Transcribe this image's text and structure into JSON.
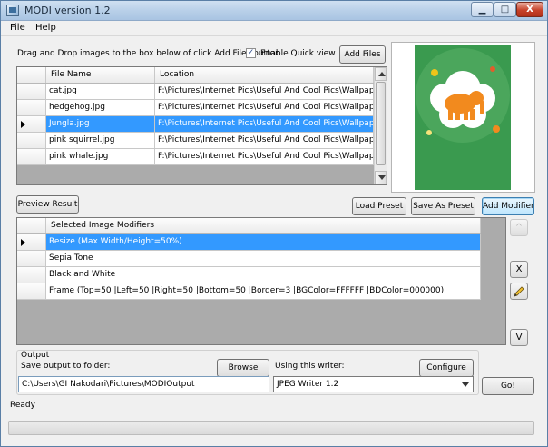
{
  "window": {
    "title": "MODI version 1.2"
  },
  "titlebar": {
    "minimize": "▁",
    "maximize": "□",
    "close": "X"
  },
  "menu": {
    "items": [
      "File",
      "Help"
    ]
  },
  "files": {
    "instruction": "Drag and Drop images to the box below of click Add Files button",
    "enable_quick_view_label": "Enable Quick view",
    "enable_quick_view_checked": true,
    "check_mark": "✓",
    "add_files_label": "Add Files",
    "columns": [
      "File Name",
      "Location"
    ],
    "rows": [
      {
        "name": "cat.jpg",
        "location": "F:\\Pictures\\Internet Pics\\Useful And Cool Pics\\Wallpapers\\Ph",
        "selected": false
      },
      {
        "name": "hedgehog.jpg",
        "location": "F:\\Pictures\\Internet Pics\\Useful And Cool Pics\\Wallpapers\\Ph",
        "selected": false
      },
      {
        "name": "Jungla.jpg",
        "location": "F:\\Pictures\\Internet Pics\\Useful And Cool Pics\\Wallpapers\\Ph",
        "selected": true
      },
      {
        "name": "pink squirrel.jpg",
        "location": "F:\\Pictures\\Internet Pics\\Useful And Cool Pics\\Wallpapers\\Ph",
        "selected": false
      },
      {
        "name": "pink whale.jpg",
        "location": "F:\\Pictures\\Internet Pics\\Useful And Cool Pics\\Wallpapers\\Ph",
        "selected": false
      }
    ]
  },
  "preview": {
    "background_color": "#3a9a4f",
    "cloud_color": "#ffffff",
    "elephant_color": "#f28a1e"
  },
  "actions": {
    "preview_result": "Preview Result",
    "load_preset": "Load Preset",
    "save_as_preset": "Save As Preset",
    "add_modifier": "Add Modifier"
  },
  "modifiers": {
    "column": "Selected Image Modifiers",
    "rows": [
      {
        "label": "Resize (Max Width/Height=50%)",
        "selected": true
      },
      {
        "label": "Sepia Tone",
        "selected": false
      },
      {
        "label": "Black and White",
        "selected": false
      },
      {
        "label": "Frame (Top=50 |Left=50 |Right=50 |Bottom=50 |Border=3 |BGColor=FFFFFF |BDColor=000000)",
        "selected": false
      }
    ],
    "move_up": "^",
    "remove": "X",
    "edit_icon": "pencil-icon",
    "move_down": "V"
  },
  "output": {
    "group_label": "Output",
    "save_label": "Save output to folder:",
    "browse": "Browse",
    "folder": "C:\\Users\\GI Nakodari\\Pictures\\MODIOutput",
    "writer_label": "Using this writer:",
    "configure": "Configure",
    "writer": "JPEG Writer 1.2",
    "go": "Go!"
  },
  "status": {
    "text": "Ready"
  },
  "colors": {
    "selection": "#3399ff",
    "accent_border": "#3c7fb1"
  }
}
